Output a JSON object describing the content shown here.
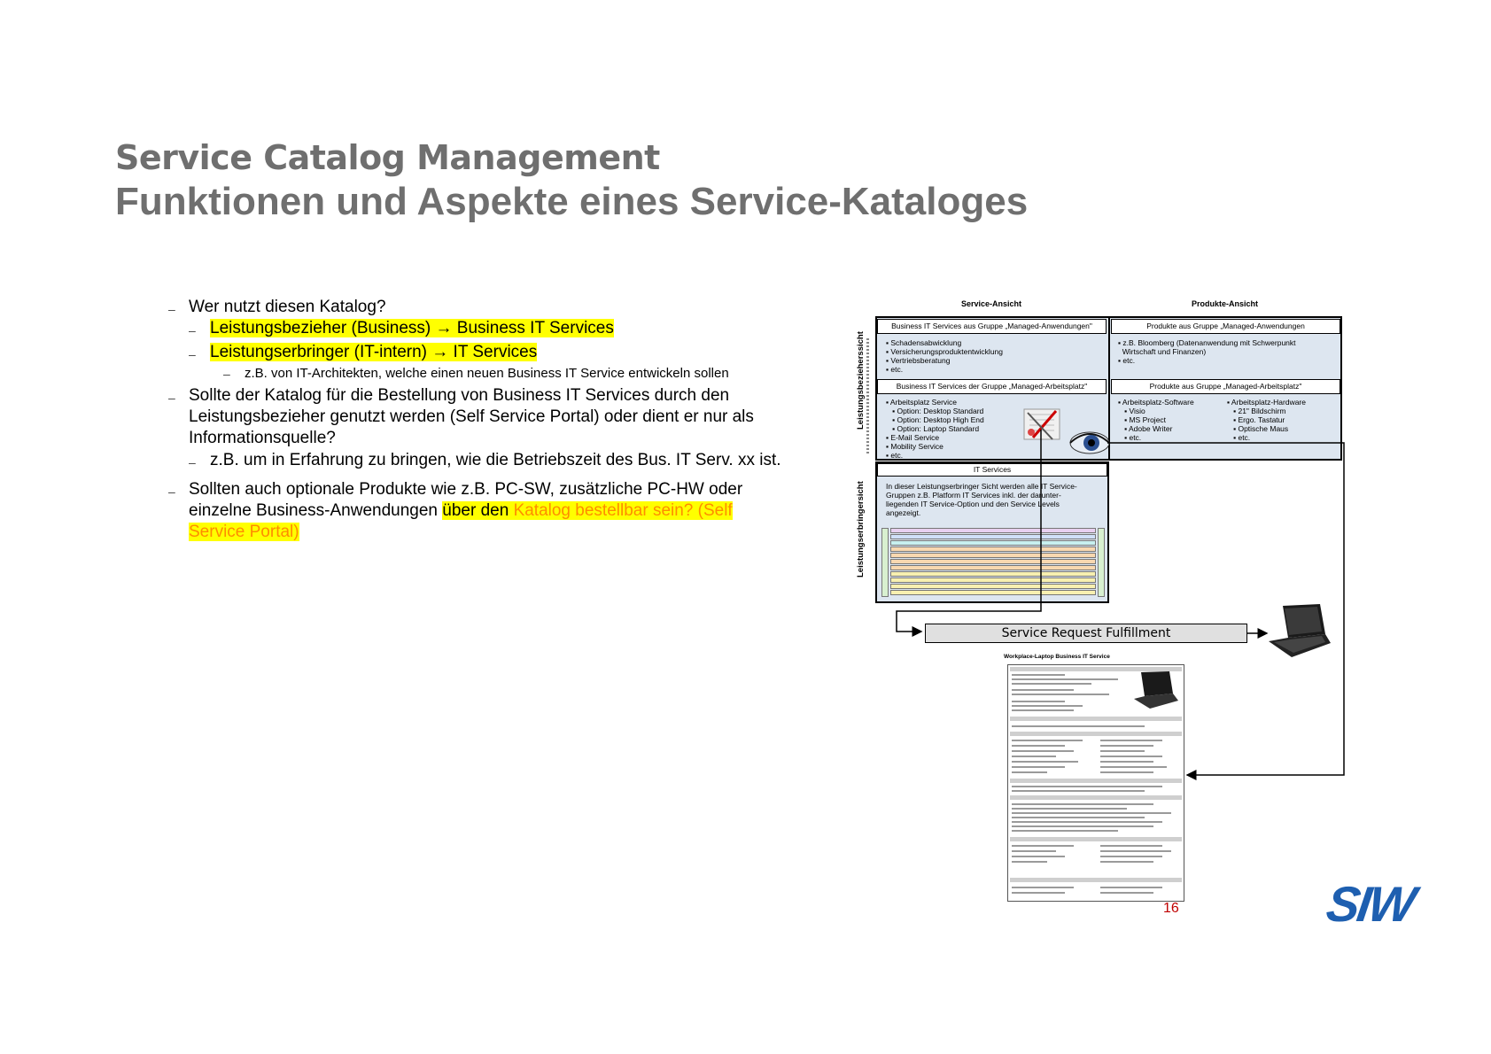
{
  "title": "Service Catalog Management",
  "subtitle": "Funktionen und Aspekte eines Service-Kataloges",
  "bullets": {
    "b1": "Wer nutzt diesen Katalog?",
    "b1a": "Leistungsbezieher (Business) → Business IT Services",
    "b1b": "Leistungserbringer (IT-intern) → IT Services",
    "b1b_i": "z.B. von IT-Architekten, welche einen neuen Business IT Service entwickeln sollen",
    "b2_l1": "Sollte der Katalog für die Bestellung von Business IT Services durch den",
    "b2_l2": "Leistungsbezieher genutzt werden (Self Service Portal) oder dient er nur als",
    "b2_l3": "Informationsquelle?",
    "b2a": "z.B. um in Erfahrung zu bringen, wie die Betriebszeit des Bus. IT Serv. xx ist.",
    "b3_l1": "Sollten auch optionale Produkte wie z.B. PC-SW, zusätzliche PC-HW oder",
    "b3_l2a": "einzelne Business-Anwendungen ",
    "b3_l2b": "über den ",
    "b3_l2c": "Katalog bestellbar sein? (Self",
    "b3_l3": "Service Portal)"
  },
  "diagram": {
    "service_header": "Service-Ansicht",
    "product_header": "Produkte-Ansicht",
    "vert_top": "Leistungsbezieherssicht",
    "vert_bottom": "Leistungserbringersicht",
    "row1_left": "Business IT Services aus Gruppe „Managed-Anwendungen\"",
    "row1_right": "Produkte aus Gruppe „Managed-Anwendungen",
    "row1_left_items": [
      "Schadensabwicklung",
      "Versicherungsproduktentwicklung",
      "Vertriebsberatung",
      "etc."
    ],
    "row1_right_items": [
      "z.B. Bloomberg (Datenanwendung mit Schwerpunkt",
      "Wirtschaft und Finanzen)",
      "etc."
    ],
    "row2_left": "Business IT Services der Gruppe „Managed-Arbeitsplatz\"",
    "row2_right": "Produkte aus Gruppe „Managed-Arbeitsplatz\"",
    "row2_left_items": [
      "Arbeitsplatz Service",
      "Option: Desktop Standard",
      "Option: Desktop High End",
      "Option: Laptop Standard",
      "E-Mail Service",
      "Mobility Service",
      "etc."
    ],
    "sw_header": "Arbeitsplatz-Software",
    "sw_items": [
      "Visio",
      "MS Project",
      "Adobe Writer",
      "etc."
    ],
    "hw_header": "Arbeitsplatz-Hardware",
    "hw_items": [
      "21\" Bildschirm",
      "Ergo. Tastatur",
      "Optische Maus",
      "etc."
    ],
    "it_services": "IT Services",
    "it_text": [
      "In dieser Leistungserbringer Sicht werden alle IT Service-",
      "Gruppen z.B. Platform IT Services inkl. der darunter-",
      "liegenden IT Service-Option und den Service Levels",
      "angezeigt."
    ],
    "srf_label": "Service Request Fulfillment",
    "doc_title": "Workplace-Laptop Business IT Service"
  },
  "page_number": "16",
  "logo": "SIW",
  "colors": {
    "title": "#6f6f6f",
    "highlight": "#ffff00",
    "orange": "#ff8c00",
    "logo": "#1e5fb0",
    "page_number": "#c00000",
    "panel": "#dde6f0"
  }
}
